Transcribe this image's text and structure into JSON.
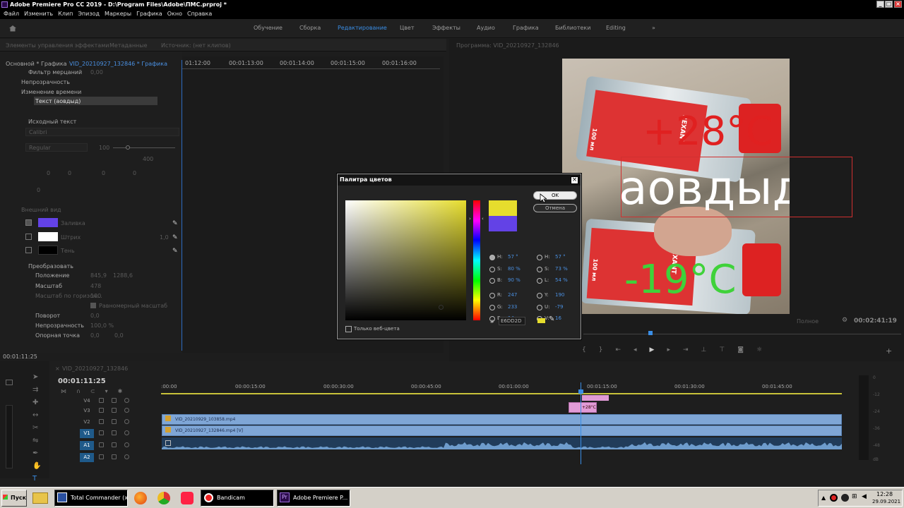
{
  "window": {
    "title": "Adobe Premiere Pro CC 2019 - D:\\Program Files\\Adobe\\ПМС.prproj *"
  },
  "menu": [
    "Файл",
    "Изменить",
    "Клип",
    "Эпизод",
    "Маркеры",
    "Графика",
    "Окно",
    "Справка"
  ],
  "workspaces": [
    "Обучение",
    "Сборка",
    "Редактирование",
    "Цвет",
    "Эффекты",
    "Аудио",
    "Графика",
    "Библиотеки",
    "Editing"
  ],
  "workspace_more": "»",
  "effects": {
    "tabs": [
      "Элементы управления эффектами",
      "Метаданные",
      "Источник: (нет клипов)"
    ],
    "sequence_left": "Основной * Графика",
    "sequence_right": "VID_20210927_132846 * Графика",
    "ruler": [
      "01:12:00",
      "00:01:13:00",
      "00:01:14:00",
      "00:01:15:00",
      "00:01:16:00"
    ],
    "rows": {
      "flicker": "Фильтр мерцаний",
      "flicker_val": "0,00",
      "opacity": "Непрозрачность",
      "timewarp": "Изменение времени",
      "text_layer": "Текст (аовдыд)",
      "source_text": "Исходный текст",
      "font": "Calibri",
      "style": "Regular",
      "size": "100",
      "tracking_val": "400",
      "va1": "0",
      "va2": "0",
      "a1": "0",
      "a2": "0",
      "appearance": "Внешний вид",
      "fill": "Заливка",
      "stroke": "Штрих",
      "stroke_val": "1,0",
      "shadow": "Тень",
      "transform": "Преобразовать",
      "position": "Положение",
      "position_x": "845,9",
      "position_y": "1288,6",
      "scale": "Масштаб",
      "scale_val": "478",
      "scale_w": "Масштаб по горизон...",
      "scale_w_val": "100",
      "uniform": "Равномерный масштаб",
      "rotation": "Поворот",
      "rotation_val": "0,0",
      "opacity2": "Непрозрачность",
      "opacity2_val": "100,0 %",
      "anchor": "Опорная точка",
      "anchor_x": "0,0",
      "anchor_y": "0,0"
    },
    "timecode": "00:01:11:25",
    "colors": {
      "fill": "#6342e6",
      "stroke": "#ffffff",
      "shadow": "#000000"
    }
  },
  "program": {
    "tab": "Программа: VID_20210927_132846",
    "fit": "Полное",
    "timecode": "00:02:41:19",
    "text_red": "+28°C",
    "text_white": "аовдыд",
    "text_green": "-19°C",
    "label_brand": "REXANT",
    "label_vol": "100 мл"
  },
  "color_picker": {
    "title": "Палитра цветов",
    "ok": "OK",
    "cancel": "Отмена",
    "web_only": "Только веб-цвета",
    "hex_prefix": "#",
    "hex": "E6DD2D",
    "new_color": "#e6dd2d",
    "old_color": "#6342e6",
    "left_fields": [
      {
        "k": "H:",
        "v": "57 °"
      },
      {
        "k": "S:",
        "v": "80 %"
      },
      {
        "k": "B:",
        "v": "90 %"
      },
      {
        "k": "R:",
        "v": "247"
      },
      {
        "k": "G:",
        "v": "233"
      },
      {
        "k": "B:",
        "v": "14"
      }
    ],
    "right_fields": [
      {
        "k": "H:",
        "v": "57 °"
      },
      {
        "k": "S:",
        "v": "73 %"
      },
      {
        "k": "L:",
        "v": "54 %"
      },
      {
        "k": "Y:",
        "v": "190"
      },
      {
        "k": "U:",
        "v": "-79"
      },
      {
        "k": "V:",
        "v": "16"
      }
    ]
  },
  "timeline": {
    "tab": "VID_20210927_132846",
    "timecode": "00:01:11:25",
    "ruler": [
      ":00:00",
      "00:00:15:00",
      "00:00:30:00",
      "00:00:45:00",
      "00:01:00:00",
      "00:01:15:00",
      "00:01:30:00",
      "00:01:45:00"
    ],
    "tracks": [
      "V4",
      "V3",
      "V2",
      "V1",
      "A1",
      "A2"
    ],
    "clip_v2": "VID_20210929_103858.mp4",
    "clip_v1": "VID_20210927_132846.mp4 [V]",
    "clip_graphic": "+28°C",
    "meter": [
      "0",
      "-12",
      "-24",
      "-36",
      "-48",
      "dB"
    ]
  },
  "taskbar": {
    "start": "Пуск",
    "items": [
      "Total Commander (x64...",
      "",
      "",
      "",
      "Bandicam",
      "Adobe Premiere P..."
    ],
    "time": "12:28",
    "date": "29.09.2021"
  }
}
